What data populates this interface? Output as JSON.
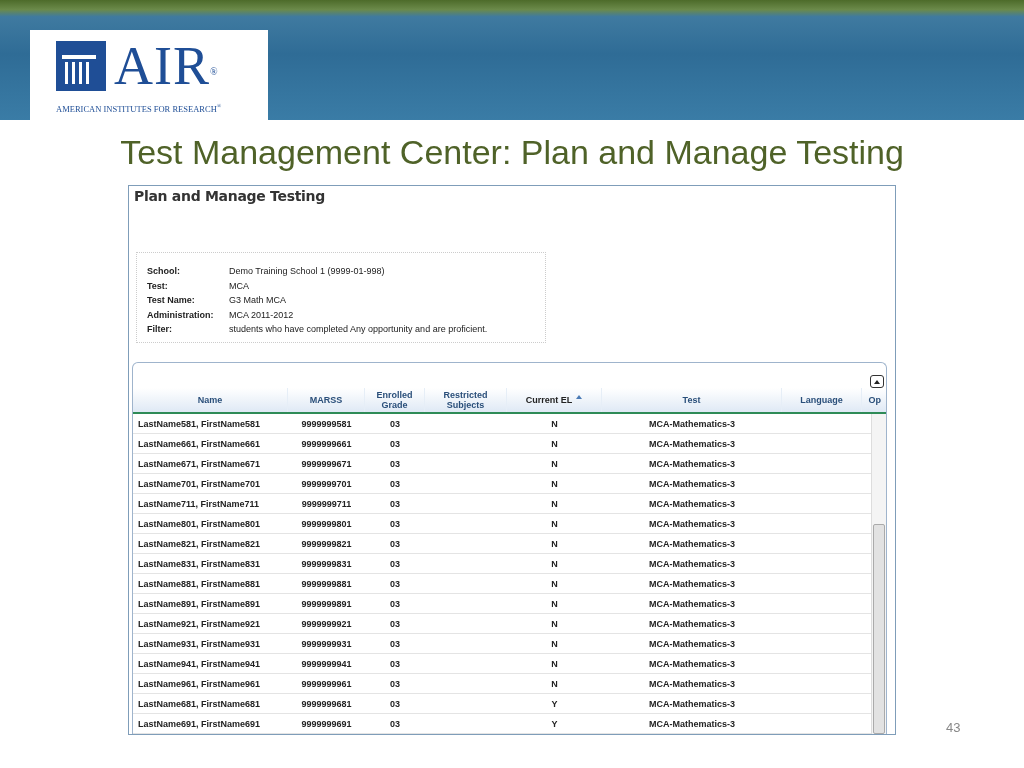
{
  "logo": {
    "wordmark": "AIR$^{®}$",
    "tagline": "AMERICAN INSTITUTES FOR RESEARCH$^{®}$"
  },
  "slide_title": "Test Management Center: Plan and Manage Testing",
  "screen": {
    "title": "Plan and Manage Testing",
    "info": [
      {
        "label": "School:",
        "value": "Demo Training School 1 (9999-01-998)"
      },
      {
        "label": "Test:",
        "value": "MCA"
      },
      {
        "label": "Test Name:",
        "value": "G3 Math MCA"
      },
      {
        "label": "Administration:",
        "value": "MCA 2011-2012"
      },
      {
        "label": "Filter:",
        "value": "students who have completed Any opportunity and are proficient."
      }
    ],
    "table": {
      "columns": [
        {
          "label": "Name",
          "sorted": false
        },
        {
          "label": "MARSS",
          "sorted": false
        },
        {
          "label": "Enrolled Grade",
          "sorted": false
        },
        {
          "label": "Restricted Subjects",
          "sorted": false
        },
        {
          "label": "Current EL",
          "sorted": true
        },
        {
          "label": "Test",
          "sorted": false
        },
        {
          "label": "Language",
          "sorted": false
        },
        {
          "label": "Op",
          "sorted": false
        }
      ],
      "rows": [
        {
          "name": "LastName581, FirstName581",
          "marss": "9999999581",
          "grade": "03",
          "el": "N",
          "test": "MCA-Mathematics-3"
        },
        {
          "name": "LastName661, FirstName661",
          "marss": "9999999661",
          "grade": "03",
          "el": "N",
          "test": "MCA-Mathematics-3"
        },
        {
          "name": "LastName671, FirstName671",
          "marss": "9999999671",
          "grade": "03",
          "el": "N",
          "test": "MCA-Mathematics-3"
        },
        {
          "name": "LastName701, FirstName701",
          "marss": "9999999701",
          "grade": "03",
          "el": "N",
          "test": "MCA-Mathematics-3"
        },
        {
          "name": "LastName711, FirstName711",
          "marss": "9999999711",
          "grade": "03",
          "el": "N",
          "test": "MCA-Mathematics-3"
        },
        {
          "name": "LastName801, FirstName801",
          "marss": "9999999801",
          "grade": "03",
          "el": "N",
          "test": "MCA-Mathematics-3"
        },
        {
          "name": "LastName821, FirstName821",
          "marss": "9999999821",
          "grade": "03",
          "el": "N",
          "test": "MCA-Mathematics-3"
        },
        {
          "name": "LastName831, FirstName831",
          "marss": "9999999831",
          "grade": "03",
          "el": "N",
          "test": "MCA-Mathematics-3"
        },
        {
          "name": "LastName881, FirstName881",
          "marss": "9999999881",
          "grade": "03",
          "el": "N",
          "test": "MCA-Mathematics-3"
        },
        {
          "name": "LastName891, FirstName891",
          "marss": "9999999891",
          "grade": "03",
          "el": "N",
          "test": "MCA-Mathematics-3"
        },
        {
          "name": "LastName921, FirstName921",
          "marss": "9999999921",
          "grade": "03",
          "el": "N",
          "test": "MCA-Mathematics-3"
        },
        {
          "name": "LastName931, FirstName931",
          "marss": "9999999931",
          "grade": "03",
          "el": "N",
          "test": "MCA-Mathematics-3"
        },
        {
          "name": "LastName941, FirstName941",
          "marss": "9999999941",
          "grade": "03",
          "el": "N",
          "test": "MCA-Mathematics-3"
        },
        {
          "name": "LastName961, FirstName961",
          "marss": "9999999961",
          "grade": "03",
          "el": "N",
          "test": "MCA-Mathematics-3"
        },
        {
          "name": "LastName681, FirstName681",
          "marss": "9999999681",
          "grade": "03",
          "el": "Y",
          "test": "MCA-Mathematics-3"
        },
        {
          "name": "LastName691, FirstName691",
          "marss": "9999999691",
          "grade": "03",
          "el": "Y",
          "test": "MCA-Mathematics-3"
        }
      ]
    }
  },
  "page_number": "43"
}
